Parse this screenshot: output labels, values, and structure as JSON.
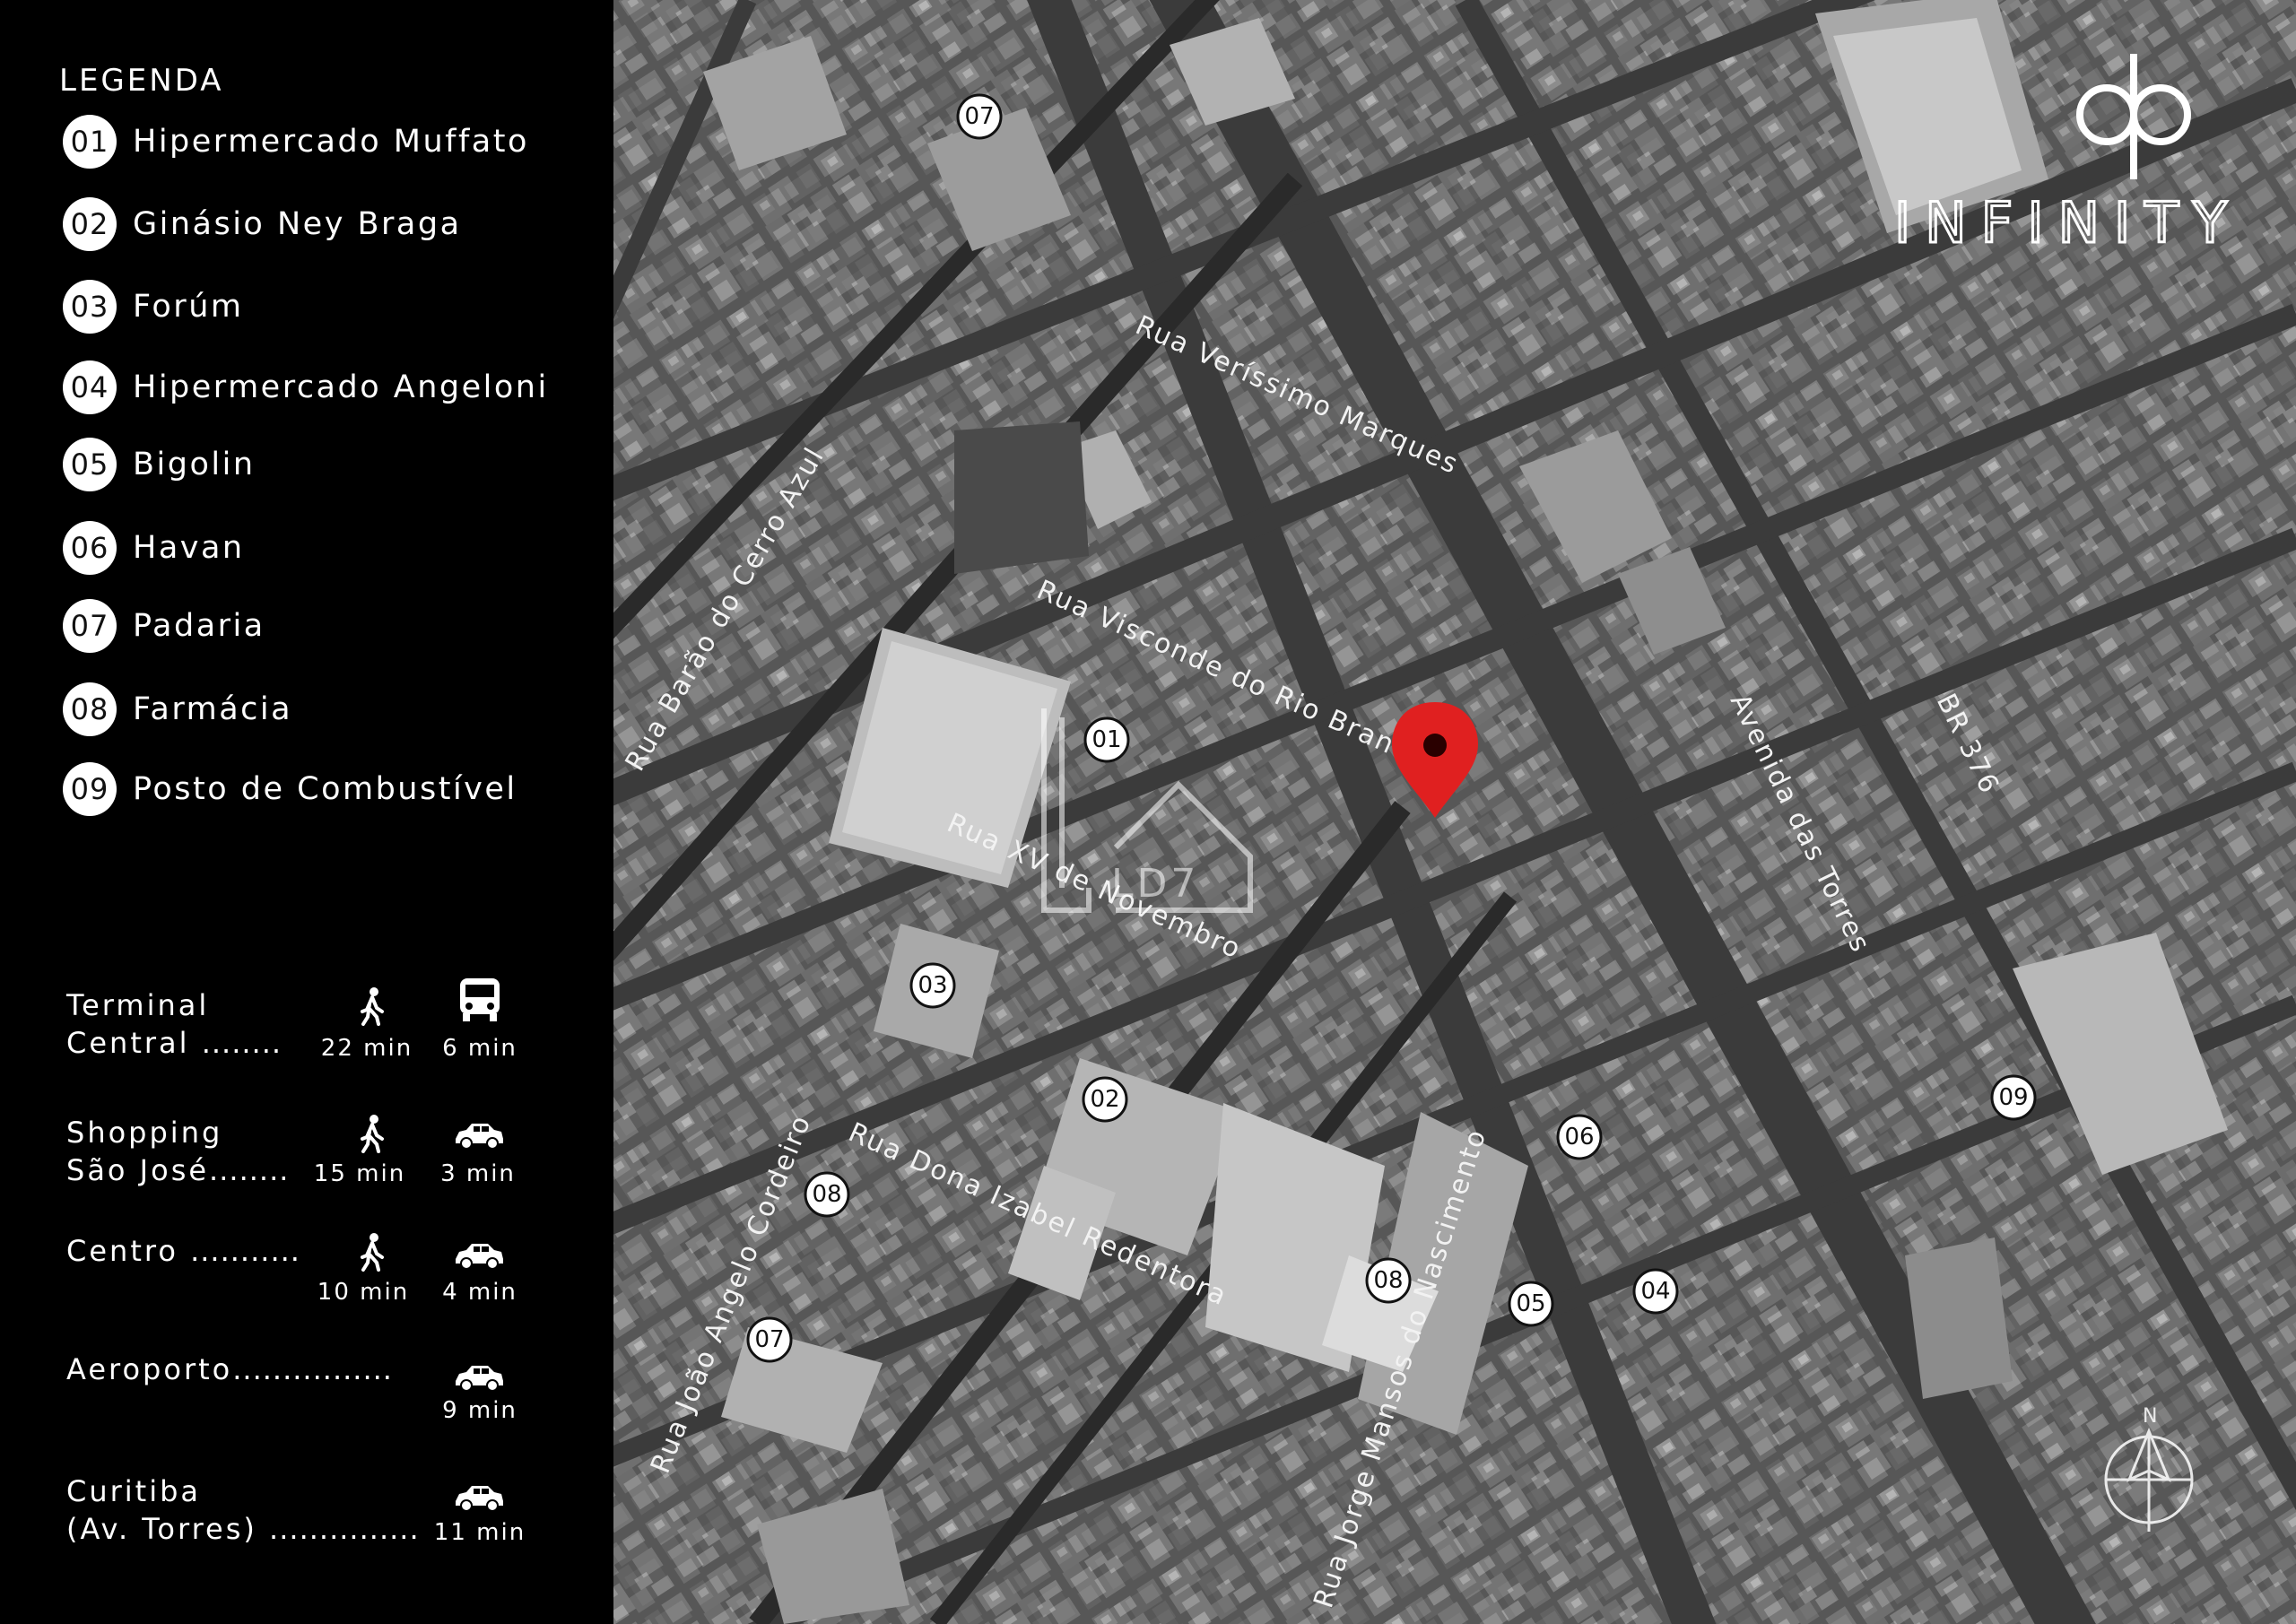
{
  "legend": {
    "title": "LEGENDA",
    "items": [
      {
        "num": "01",
        "label": "Hipermercado Muffato"
      },
      {
        "num": "02",
        "label": "Ginásio Ney Braga"
      },
      {
        "num": "03",
        "label": "Forúm"
      },
      {
        "num": "04",
        "label": "Hipermercado Angeloni"
      },
      {
        "num": "05",
        "label": "Bigolin"
      },
      {
        "num": "06",
        "label": "Havan"
      },
      {
        "num": "07",
        "label": "Padaria"
      },
      {
        "num": "08",
        "label": "Farmácia"
      },
      {
        "num": "09",
        "label": "Posto de Combustível"
      }
    ]
  },
  "distances": [
    {
      "line1": "Terminal",
      "line2": "Central",
      "dots": "........",
      "walk": "22 min",
      "vehicle": "6 min",
      "vehicle_icon": "bus-icon"
    },
    {
      "line1": "Shopping",
      "line2": "São José",
      "dots": "........",
      "walk": "15 min",
      "vehicle": "3 min",
      "vehicle_icon": "car-icon"
    },
    {
      "line1": "",
      "line2": "Centro",
      "dots": "...........",
      "walk": "10 min",
      "vehicle": "4 min",
      "vehicle_icon": "car-icon"
    },
    {
      "line1": "",
      "line2": "Aeroporto",
      "dots": "................",
      "walk": "",
      "vehicle": "9 min",
      "vehicle_icon": "car-icon"
    },
    {
      "line1": "Curitiba",
      "line2": "(Av. Torres)",
      "dots": "...............",
      "walk": "",
      "vehicle": "11 min",
      "vehicle_icon": "car-icon"
    }
  ],
  "brand": {
    "name": "INFINITY",
    "monogram": "dp",
    "watermark": "LD7"
  },
  "map": {
    "streets": [
      "Rua Veríssimo Marques",
      "Rua Visconde do Rio Branco",
      "Rua XV de Novembro",
      "Rua Barão do Cerro Azul",
      "Rua Dona Izabel Redentora",
      "Rua João Angelo Cordeiro",
      "Rua Jorge Mansos do Nascimento",
      "Avenida das Torres",
      "BR 376"
    ],
    "markers": [
      "07",
      "01",
      "03",
      "02",
      "08",
      "07",
      "06",
      "05",
      "04",
      "08",
      "09"
    ],
    "compass_label": "N",
    "pin_color": "#e02020"
  }
}
